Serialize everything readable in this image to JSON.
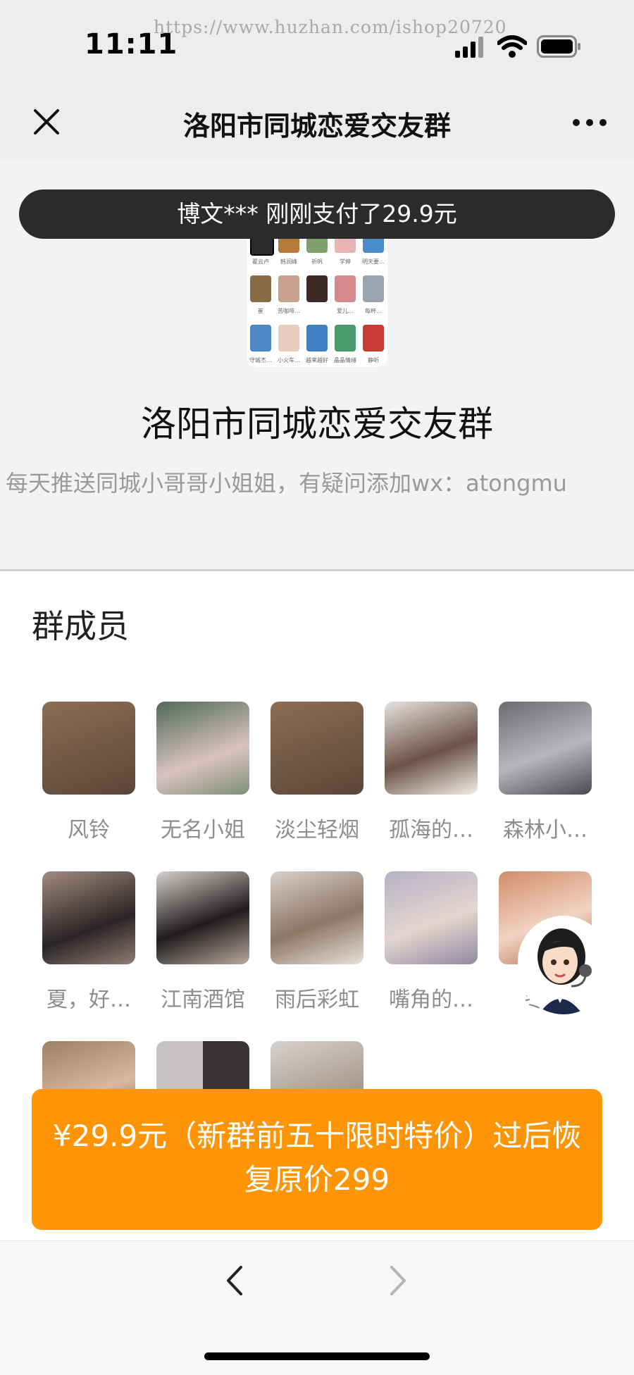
{
  "status_bar": {
    "time": "11:11",
    "watermark": "https://www.huzhan.com/ishop20720",
    "icons": [
      "signal-icon",
      "wifi-icon",
      "battery-icon"
    ]
  },
  "nav": {
    "title": "洛阳市同城恋爱交友群",
    "close_icon": "close-icon",
    "more_icon": "more-icon"
  },
  "toast": {
    "text": "博文*** 刚刚支付了29.9元"
  },
  "group_avatar": {
    "labels": [
      "翟云卢",
      "韩润峰",
      "祈帆",
      "学婷",
      "明天要…",
      "崔",
      "苦咖啡…",
      "",
      "爱儿…",
      "每杯…",
      "守城杰…",
      "小火车…",
      "越来越好",
      "晶晶情绪",
      "静听"
    ]
  },
  "group": {
    "title": "洛阳市同城恋爱交友群",
    "description": "每天推送同城小哥哥小姐姐，有疑问添加wx：atongmu"
  },
  "members": {
    "heading": "群成员",
    "list": [
      {
        "name": "风铃"
      },
      {
        "name": "无名小姐"
      },
      {
        "name": "淡尘轻烟"
      },
      {
        "name": "孤海的…"
      },
      {
        "name": "森林小…"
      },
      {
        "name": "夏，好…"
      },
      {
        "name": "江南酒馆"
      },
      {
        "name": "雨后彩虹"
      },
      {
        "name": "嘴角的…"
      },
      {
        "name": "冬…"
      },
      {
        "name": ""
      },
      {
        "name": ""
      },
      {
        "name": ""
      }
    ],
    "more_dots": "• • •"
  },
  "cta": {
    "text": "¥29.9元（新群前五十限时特价）过后恢复原价299"
  },
  "toolbar": {
    "back_icon": "chevron-left-icon",
    "forward_icon": "chevron-right-icon"
  },
  "colors": {
    "cta": "#ff9505",
    "toast_bg": "#2b2b2b",
    "page_bg": "#ededed"
  }
}
